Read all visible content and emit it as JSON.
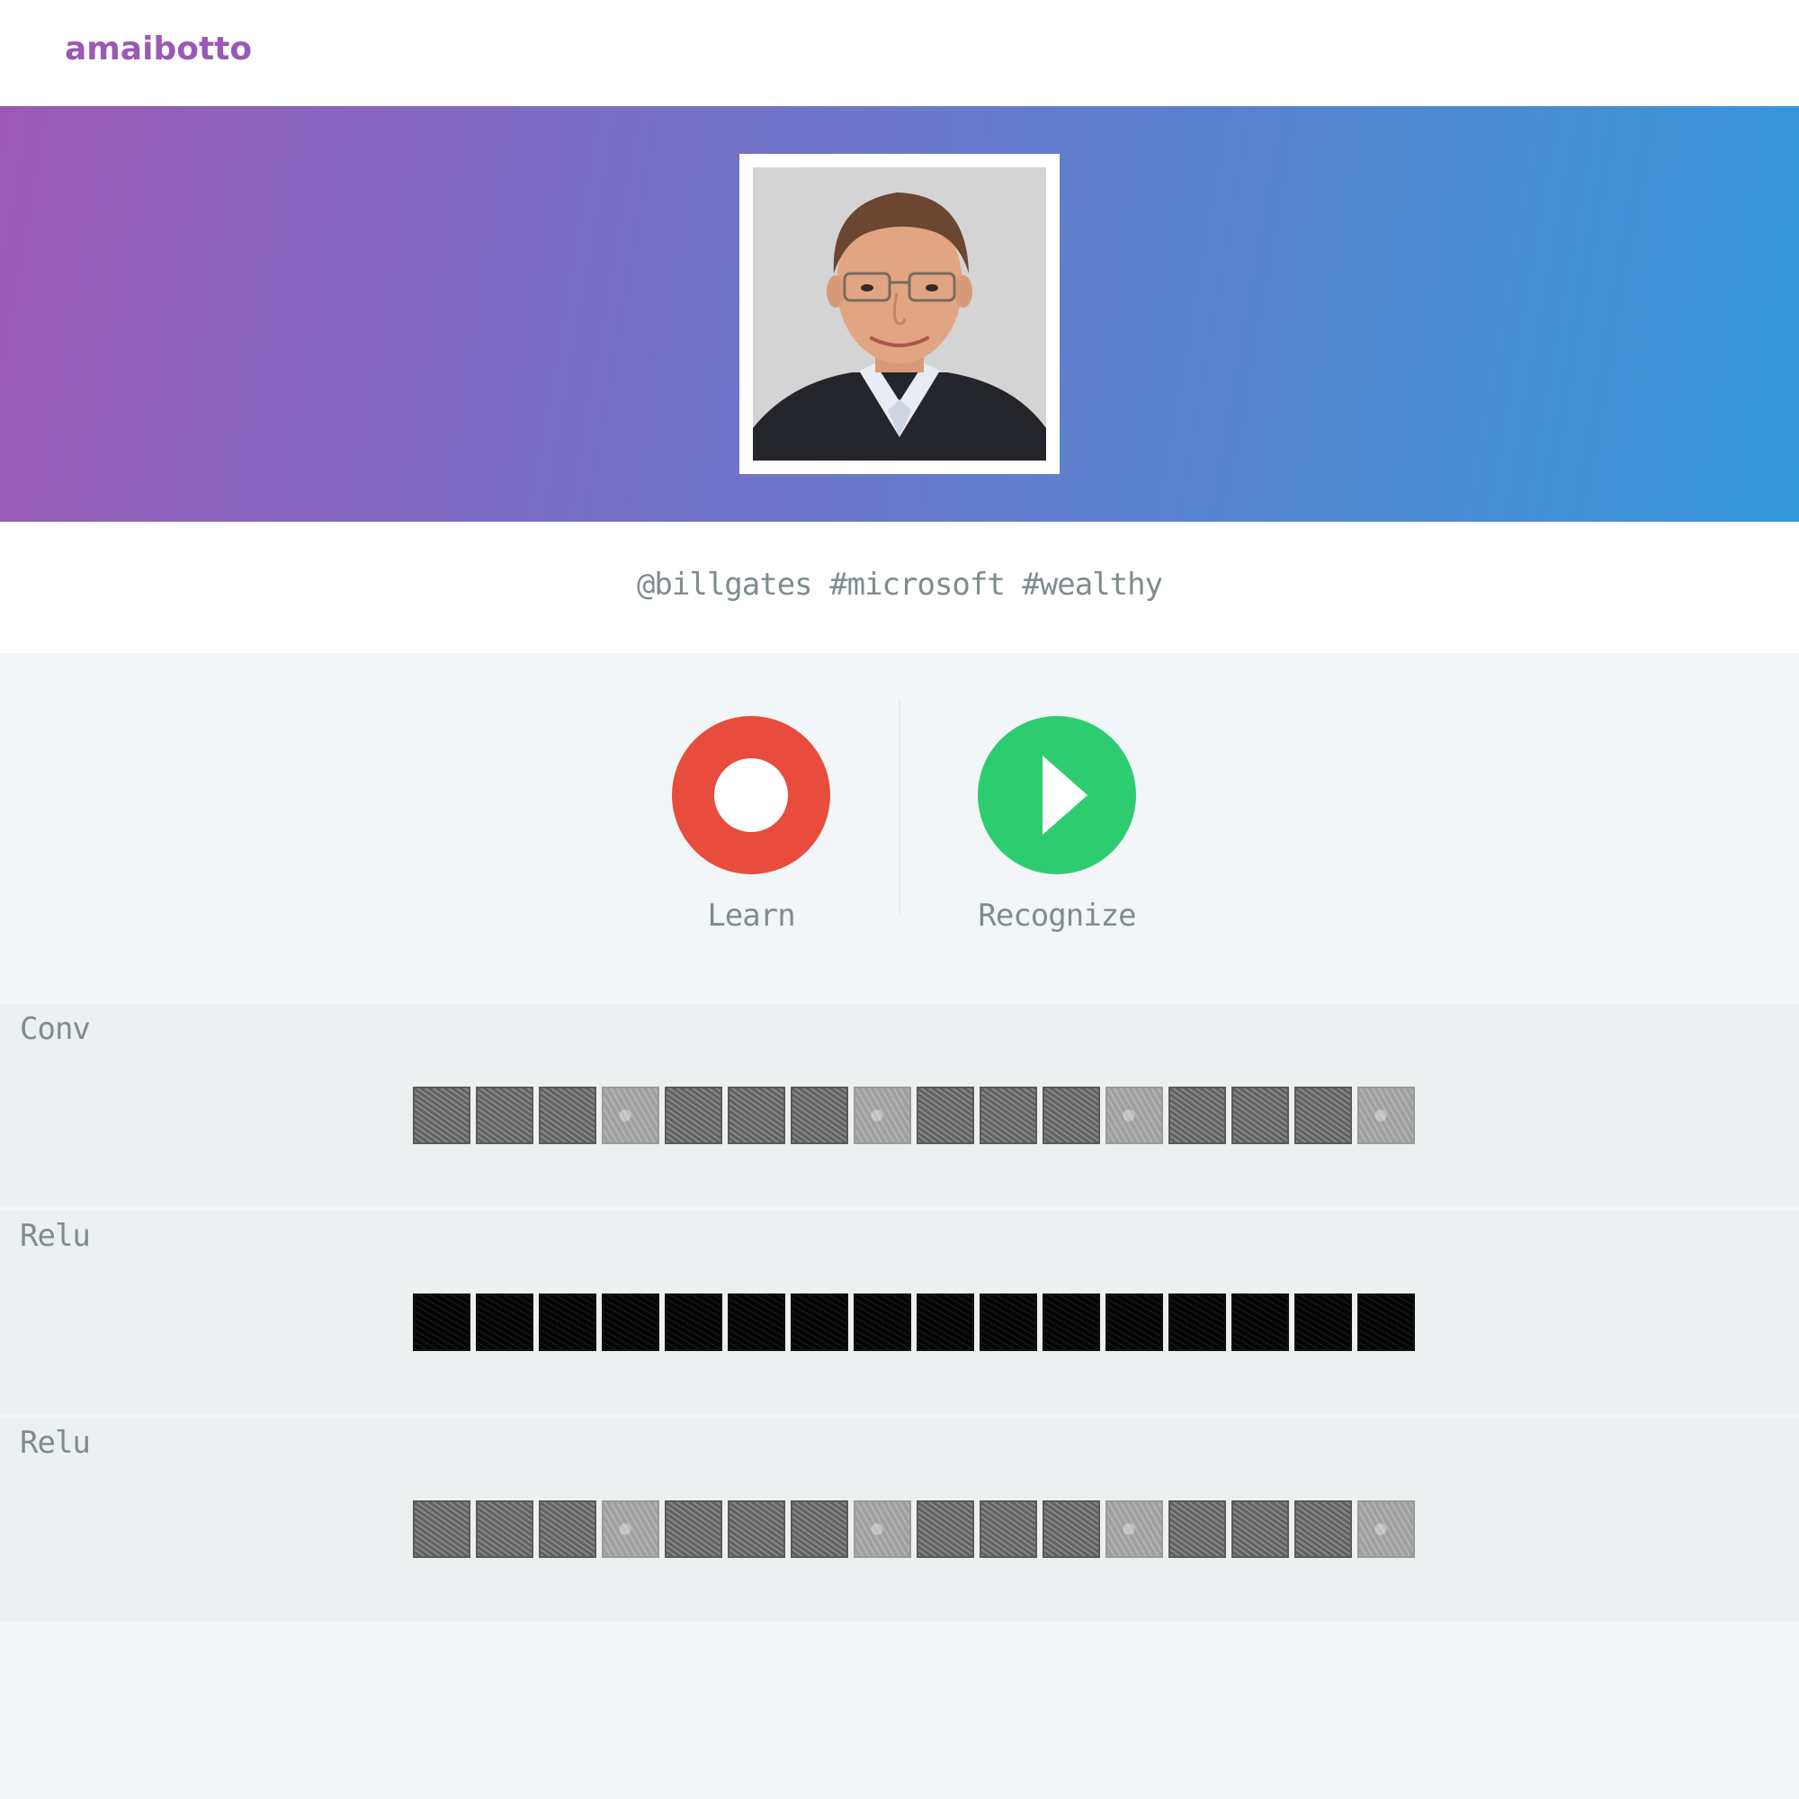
{
  "app": {
    "brand": "amaibotto"
  },
  "hero": {
    "photo_alt": "Profile photo"
  },
  "profile": {
    "tagline": "@billgates #microsoft #wealthy"
  },
  "actions": {
    "learn_label": "Learn",
    "recognize_label": "Recognize"
  },
  "colors": {
    "brand": "#9b59b6",
    "gradient_start": "#9b59b6",
    "gradient_end": "#3498db",
    "learn": "#e74c3c",
    "recognize": "#2ecc71",
    "muted_text": "#7f8c8d"
  },
  "layers": [
    {
      "title": "Conv",
      "tiles": [
        "dark",
        "dark",
        "dark",
        "light",
        "dark",
        "dark",
        "dark",
        "light",
        "dark",
        "dark",
        "dark",
        "light",
        "dark",
        "dark",
        "dark",
        "light"
      ]
    },
    {
      "title": "Relu",
      "tiles": [
        "black",
        "black",
        "black",
        "black",
        "black",
        "black",
        "black",
        "black",
        "black",
        "black",
        "black",
        "black",
        "black",
        "black",
        "black",
        "black"
      ]
    },
    {
      "title": "Relu",
      "tiles": [
        "dark",
        "dark",
        "dark",
        "light",
        "dark",
        "dark",
        "dark",
        "light",
        "dark",
        "dark",
        "dark",
        "light",
        "dark",
        "dark",
        "dark",
        "light"
      ]
    }
  ]
}
